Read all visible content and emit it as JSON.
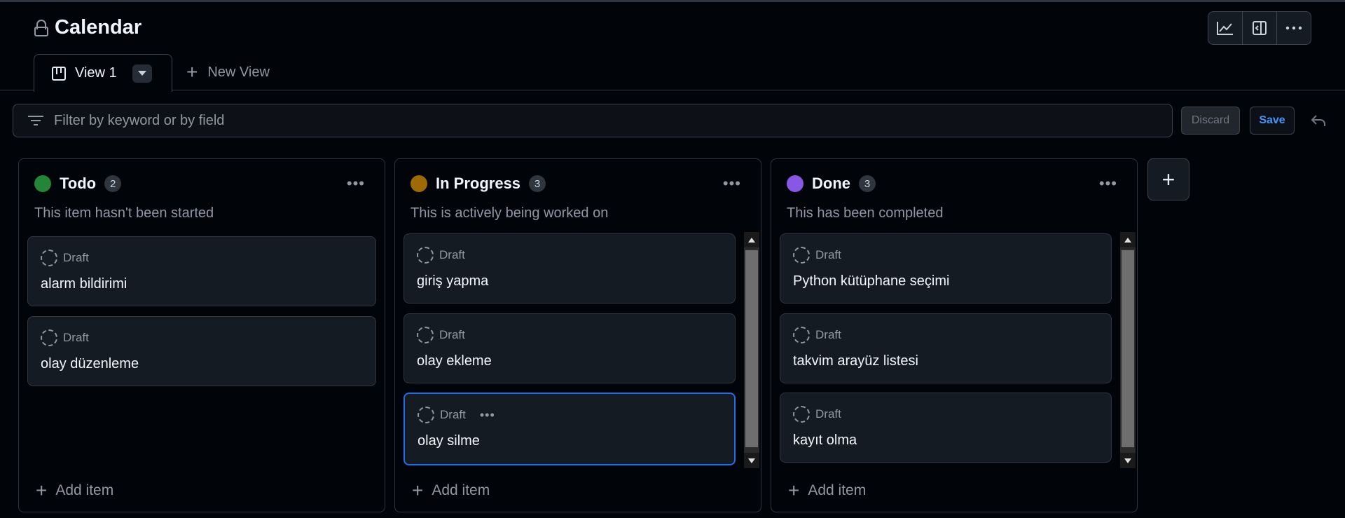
{
  "project": {
    "title": "Calendar"
  },
  "tabs": [
    {
      "label": "View 1"
    }
  ],
  "new_view_label": "New View",
  "filter": {
    "placeholder": "Filter by keyword or by field"
  },
  "actions": {
    "discard": "Discard",
    "save": "Save"
  },
  "draft_label": "Draft",
  "add_item_label": "Add item",
  "columns": [
    {
      "name": "Todo",
      "count": "2",
      "color": "#238636",
      "description": "This item hasn't been started",
      "cards": [
        {
          "title": "alarm bildirimi"
        },
        {
          "title": "olay düzenleme"
        }
      ]
    },
    {
      "name": "In Progress",
      "count": "3",
      "color": "#9e6a03",
      "description": "This is actively being worked on",
      "cards": [
        {
          "title": "giriş yapma"
        },
        {
          "title": "olay ekleme"
        },
        {
          "title": "olay silme"
        }
      ]
    },
    {
      "name": "Done",
      "count": "3",
      "color": "#8957e5",
      "description": "This has been completed",
      "cards": [
        {
          "title": "Python kütüphane seçimi"
        },
        {
          "title": "takvim arayüz listesi"
        },
        {
          "title": "kayıt olma"
        }
      ]
    }
  ]
}
